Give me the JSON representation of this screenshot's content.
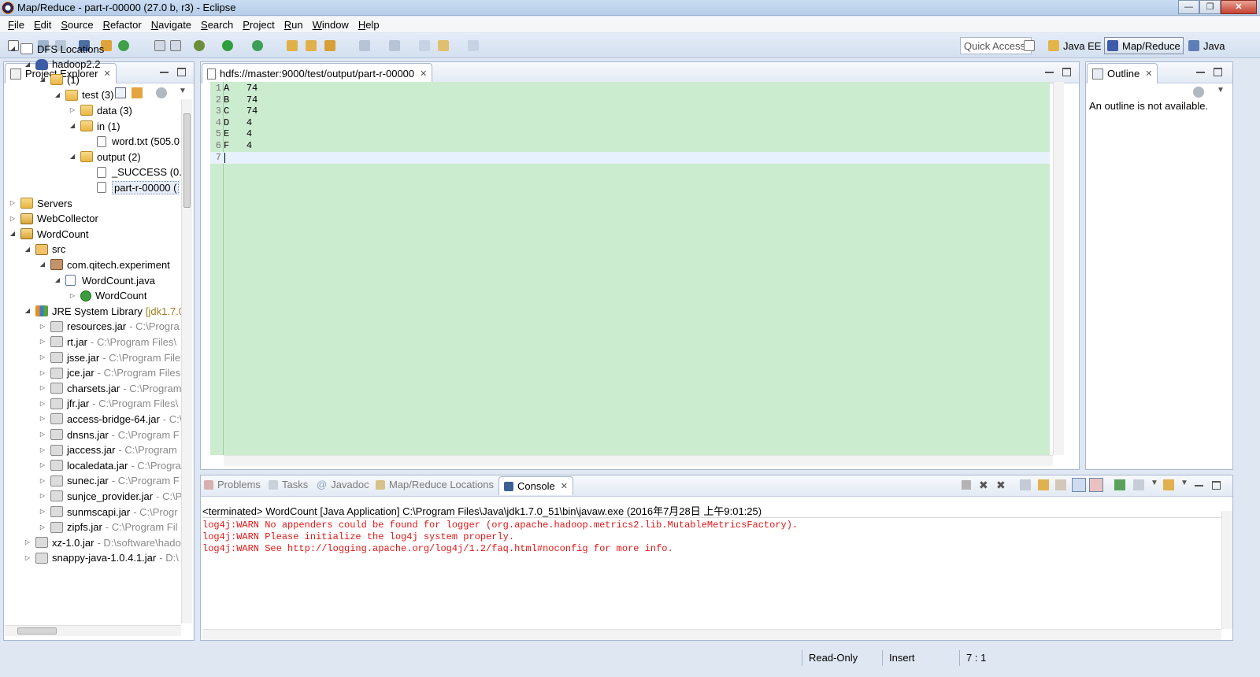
{
  "window": {
    "title": "Map/Reduce - part-r-00000 (27.0 b, r3) - Eclipse"
  },
  "menu": [
    "File",
    "Edit",
    "Source",
    "Refactor",
    "Navigate",
    "Search",
    "Project",
    "Run",
    "Window",
    "Help"
  ],
  "toolbar": {
    "quick_access": "Quick Access"
  },
  "perspectives": [
    {
      "label": "Java EE",
      "active": false
    },
    {
      "label": "Map/Reduce",
      "active": true
    },
    {
      "label": "Java",
      "active": false
    }
  ],
  "project_explorer": {
    "title": "Project Explorer",
    "tree": [
      {
        "label": "DFS Locations",
        "sub": "",
        "deco": ""
      },
      {
        "label": "hadoop2.2",
        "sub": "",
        "deco": ""
      },
      {
        "label": "(1)",
        "sub": "",
        "deco": ""
      },
      {
        "label": "test (3)",
        "sub": "",
        "deco": ""
      },
      {
        "label": "data (3)",
        "sub": "",
        "deco": ""
      },
      {
        "label": "in (1)",
        "sub": "",
        "deco": ""
      },
      {
        "label": "word.txt (505.0",
        "sub": "",
        "deco": ""
      },
      {
        "label": "output (2)",
        "sub": "",
        "deco": ""
      },
      {
        "label": "_SUCCESS (0.0",
        "sub": "",
        "deco": ""
      },
      {
        "label": "part-r-00000 (",
        "sub": "",
        "deco": ""
      },
      {
        "label": "Servers",
        "sub": "",
        "deco": ""
      },
      {
        "label": "WebCollector",
        "sub": "",
        "deco": ""
      },
      {
        "label": "WordCount",
        "sub": "",
        "deco": ""
      },
      {
        "label": "src",
        "sub": "",
        "deco": ""
      },
      {
        "label": "com.qitech.experiment",
        "sub": "",
        "deco": ""
      },
      {
        "label": "WordCount.java",
        "sub": "",
        "deco": ""
      },
      {
        "label": "WordCount",
        "sub": "",
        "deco": ""
      },
      {
        "label": "JRE System Library",
        "sub": "",
        "deco": "[jdk1.7.0"
      },
      {
        "label": "resources.jar",
        "sub": "- C:\\Progra",
        "deco": ""
      },
      {
        "label": "rt.jar",
        "sub": "- C:\\Program Files\\",
        "deco": ""
      },
      {
        "label": "jsse.jar",
        "sub": "- C:\\Program File",
        "deco": ""
      },
      {
        "label": "jce.jar",
        "sub": "- C:\\Program Files",
        "deco": ""
      },
      {
        "label": "charsets.jar",
        "sub": "- C:\\Program",
        "deco": ""
      },
      {
        "label": "jfr.jar",
        "sub": "- C:\\Program Files\\",
        "deco": ""
      },
      {
        "label": "access-bridge-64.jar",
        "sub": "- C:\\",
        "deco": ""
      },
      {
        "label": "dnsns.jar",
        "sub": "- C:\\Program F",
        "deco": ""
      },
      {
        "label": "jaccess.jar",
        "sub": "- C:\\Program",
        "deco": ""
      },
      {
        "label": "localedata.jar",
        "sub": "- C:\\Progra",
        "deco": ""
      },
      {
        "label": "sunec.jar",
        "sub": "- C:\\Program F",
        "deco": ""
      },
      {
        "label": "sunjce_provider.jar",
        "sub": "- C:\\P",
        "deco": ""
      },
      {
        "label": "sunmscapi.jar",
        "sub": "- C:\\Progr",
        "deco": ""
      },
      {
        "label": "zipfs.jar",
        "sub": "- C:\\Program Fil",
        "deco": ""
      },
      {
        "label": "xz-1.0.jar",
        "sub": "- D:\\software\\hado",
        "deco": ""
      },
      {
        "label": "snappy-java-1.0.4.1.jar",
        "sub": "- D:\\",
        "deco": ""
      }
    ]
  },
  "editor": {
    "tab": "hdfs://master:9000/test/output/part-r-00000",
    "lines": [
      {
        "num": "1",
        "text": "A\t74"
      },
      {
        "num": "2",
        "text": "B\t74"
      },
      {
        "num": "3",
        "text": "C\t74"
      },
      {
        "num": "4",
        "text": "D\t4"
      },
      {
        "num": "5",
        "text": "E\t4"
      },
      {
        "num": "6",
        "text": "F\t4"
      },
      {
        "num": "7",
        "text": ""
      }
    ]
  },
  "outline": {
    "title": "Outline",
    "message": "An outline is not available."
  },
  "bottom_tabs": [
    "Problems",
    "Tasks",
    "Javadoc",
    "Map/Reduce Locations",
    "Console"
  ],
  "console": {
    "header": "<terminated> WordCount [Java Application] C:\\Program Files\\Java\\jdk1.7.0_51\\bin\\javaw.exe (2016年7月28日 上午9:01:25)",
    "lines": [
      "log4j:WARN No appenders could be found for logger (org.apache.hadoop.metrics2.lib.MutableMetricsFactory).",
      "log4j:WARN Please initialize the log4j system properly.",
      "log4j:WARN See http://logging.apache.org/log4j/1.2/faq.html#noconfig for more info."
    ]
  },
  "status": {
    "mode": "Read-Only",
    "insert": "Insert",
    "position": "7 : 1"
  }
}
